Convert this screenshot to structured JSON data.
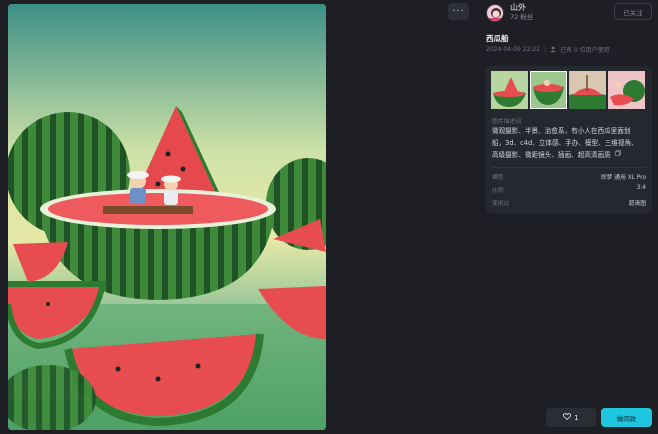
{
  "toolbar": {
    "more_label": "···"
  },
  "author": {
    "name": "山外",
    "followers": "72 粉丝",
    "follow_label": "已关注"
  },
  "work": {
    "title": "西瓜船",
    "date": "2024-04-09 22:22",
    "usage": "已有 0 位用户使用"
  },
  "details": {
    "prompt_label": "图片描述词",
    "prompt": "微观摄影、半景、治愈系，有小人在西瓜里面划船，3d、c4d、立体感、手办、模型、三维视角、高级摄影、微距镜头、插画、超高清画质",
    "rows": [
      {
        "key": "模型",
        "value": "即梦 通用 XL Pro"
      },
      {
        "key": "比例",
        "value": "3:4"
      },
      {
        "key": "使用过",
        "value": "超清图"
      }
    ]
  },
  "actions": {
    "likes": "1",
    "use_label": "做同款"
  },
  "icons": {
    "more": "more-icon",
    "heart": "heart-icon",
    "copy": "copy-icon",
    "user": "user-icon"
  },
  "colors": {
    "background": "#1d1f24",
    "panel": "#25282e",
    "accent": "#1fc6e0"
  }
}
